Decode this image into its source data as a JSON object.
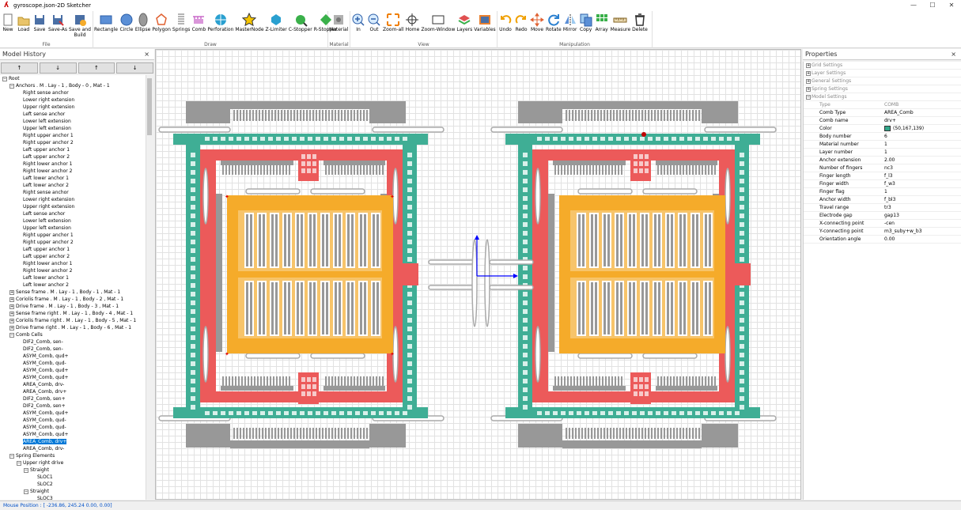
{
  "window": {
    "title": "gyroscope.json-2D Sketcher"
  },
  "toolbar": {
    "groups": [
      {
        "name": "File",
        "items": [
          "New",
          "Load",
          "Save",
          "Save-As",
          "Save and Build"
        ]
      },
      {
        "name": "Draw",
        "items": [
          "Rectangle",
          "Circle",
          "Ellipse",
          "Polygon",
          "Springs",
          "Comb",
          "Perforation",
          "MasterNode",
          "Z-Limiter",
          "C-Stopper",
          "R-Stopper"
        ]
      },
      {
        "name": "Material",
        "items": [
          "Material"
        ]
      },
      {
        "name": "View",
        "items": [
          "In",
          "Out",
          "Zoom-all",
          "Home",
          "Zoom-Window",
          "Layers",
          "Variables"
        ]
      },
      {
        "name": "Manipulation",
        "items": [
          "Undo",
          "Redo",
          "Move",
          "Rotate",
          "Mirror",
          "Copy",
          "Array",
          "Measure",
          "Delete"
        ]
      }
    ]
  },
  "model_history": {
    "title": "Model History",
    "close": "×",
    "arrows": [
      "↑",
      "↓",
      "↑",
      "↓"
    ],
    "tree": [
      {
        "level": 0,
        "exp": "−",
        "text": "Root"
      },
      {
        "level": 1,
        "exp": "−",
        "text": "Anchors . M . Lay - 1 , Body - 0 , Mat - 1"
      },
      {
        "level": 2,
        "text": "Right sense anchor"
      },
      {
        "level": 2,
        "text": "Lower right extension"
      },
      {
        "level": 2,
        "text": "Upper right extension"
      },
      {
        "level": 2,
        "text": "Left sense anchor"
      },
      {
        "level": 2,
        "text": "Lower left extension"
      },
      {
        "level": 2,
        "text": "Upper left extension"
      },
      {
        "level": 2,
        "text": "Right upper anchor 1"
      },
      {
        "level": 2,
        "text": "Right upper anchor 2"
      },
      {
        "level": 2,
        "text": "Left upper anchor 1"
      },
      {
        "level": 2,
        "text": "Left upper anchor 2"
      },
      {
        "level": 2,
        "text": "Right lower anchor 1"
      },
      {
        "level": 2,
        "text": "Right lower anchor 2"
      },
      {
        "level": 2,
        "text": "Left lower anchor 1"
      },
      {
        "level": 2,
        "text": "Left lower anchor 2"
      },
      {
        "level": 2,
        "text": "Right sense anchor"
      },
      {
        "level": 2,
        "text": "Lower right extension"
      },
      {
        "level": 2,
        "text": "Upper right extension"
      },
      {
        "level": 2,
        "text": "Left sense anchor"
      },
      {
        "level": 2,
        "text": "Lower left extension"
      },
      {
        "level": 2,
        "text": "Upper left extension"
      },
      {
        "level": 2,
        "text": "Right upper anchor 1"
      },
      {
        "level": 2,
        "text": "Right upper anchor 2"
      },
      {
        "level": 2,
        "text": "Left upper anchor 1"
      },
      {
        "level": 2,
        "text": "Left upper anchor 2"
      },
      {
        "level": 2,
        "text": "Right lower anchor 1"
      },
      {
        "level": 2,
        "text": "Right lower anchor 2"
      },
      {
        "level": 2,
        "text": "Left lower anchor 1"
      },
      {
        "level": 2,
        "text": "Left lower anchor 2"
      },
      {
        "level": 1,
        "exp": "+",
        "text": "Sense frame . M . Lay - 1 , Body - 1 , Mat - 1"
      },
      {
        "level": 1,
        "exp": "+",
        "text": "Coriolis frame . M . Lay - 1 , Body - 2 , Mat - 1"
      },
      {
        "level": 1,
        "exp": "+",
        "text": "Drive frame . M . Lay - 1 , Body - 3 , Mat - 1"
      },
      {
        "level": 1,
        "exp": "+",
        "text": "Sense frame right . M . Lay - 1 , Body - 4 , Mat - 1"
      },
      {
        "level": 1,
        "exp": "+",
        "text": "Coriolis frame right . M . Lay - 1 , Body - 5 , Mat - 1"
      },
      {
        "level": 1,
        "exp": "+",
        "text": "Drive frame right . M . Lay - 1 , Body - 6 , Mat - 1"
      },
      {
        "level": 1,
        "exp": "−",
        "text": "Comb Cells"
      },
      {
        "level": 2,
        "text": "DIF2_Comb, sen-"
      },
      {
        "level": 2,
        "text": "DIF2_Comb, sen-"
      },
      {
        "level": 2,
        "text": "ASYM_Comb, qud+"
      },
      {
        "level": 2,
        "text": "ASYM_Comb, qud-"
      },
      {
        "level": 2,
        "text": "ASYM_Comb, qud+"
      },
      {
        "level": 2,
        "text": "ASYM_Comb, qud+"
      },
      {
        "level": 2,
        "text": "AREA_Comb, drv-"
      },
      {
        "level": 2,
        "text": "AREA_Comb, drv+"
      },
      {
        "level": 2,
        "text": "DIF2_Comb, sen+"
      },
      {
        "level": 2,
        "text": "DIF2_Comb, sen+"
      },
      {
        "level": 2,
        "text": "ASYM_Comb, qud+"
      },
      {
        "level": 2,
        "text": "ASYM_Comb, qud-"
      },
      {
        "level": 2,
        "text": "ASYM_Comb, qud-"
      },
      {
        "level": 2,
        "text": "ASYM_Comb, qud+"
      },
      {
        "level": 2,
        "text": "AREA_Comb, drv+",
        "selected": true
      },
      {
        "level": 2,
        "text": "AREA_Comb, drv-"
      },
      {
        "level": 1,
        "exp": "−",
        "text": "Spring Elements"
      },
      {
        "level": 2,
        "exp": "−",
        "text": "Upper right drive"
      },
      {
        "level": 3,
        "exp": "−",
        "text": "Straight"
      },
      {
        "level": 4,
        "text": "SLOC1"
      },
      {
        "level": 4,
        "text": "SLOC2"
      },
      {
        "level": 3,
        "exp": "−",
        "text": "Straight"
      },
      {
        "level": 4,
        "text": "SLOC3"
      }
    ]
  },
  "properties": {
    "title": "Properties",
    "close": "×",
    "categories": [
      {
        "name": "Grid Settings",
        "exp": "+"
      },
      {
        "name": "Layer Settings",
        "exp": "+"
      },
      {
        "name": "General Settings",
        "exp": "+"
      },
      {
        "name": "Spring Settings",
        "exp": "+"
      },
      {
        "name": "Model Settings",
        "exp": "−"
      }
    ],
    "rows": [
      {
        "k": "Type",
        "v": "COMB",
        "gray": true
      },
      {
        "k": "Comb Type",
        "v": "AREA_Comb"
      },
      {
        "k": "Comb name",
        "v": "drv+"
      },
      {
        "k": "Color",
        "v": "(50,167,139)",
        "swatch": "#32a78b"
      },
      {
        "k": "Body number",
        "v": "6"
      },
      {
        "k": "Material number",
        "v": "1"
      },
      {
        "k": "Layer number",
        "v": "1"
      },
      {
        "k": "Anchor extension",
        "v": "2.00"
      },
      {
        "k": "Number of fingers",
        "v": "nc3"
      },
      {
        "k": "Finger length",
        "v": "f_l3"
      },
      {
        "k": "Finger width",
        "v": "f_w3"
      },
      {
        "k": "Finger flag",
        "v": "1"
      },
      {
        "k": "Anchor width",
        "v": "f_bl3"
      },
      {
        "k": "Travel range",
        "v": "tr3"
      },
      {
        "k": "Electrode gap",
        "v": "gap13"
      },
      {
        "k": "X-connecting point",
        "v": "-cen"
      },
      {
        "k": "Y-connecting point",
        "v": "m3_suby+w_b3"
      },
      {
        "k": "Orientation angle",
        "v": "0.00"
      }
    ]
  },
  "status": {
    "text": "Mouse Position : [ -236.86, 245.24    0.00, 0.00]"
  },
  "colors": {
    "teal": "#3fae95",
    "red": "#ec5a5a",
    "orange": "#f5ab2a",
    "gray": "#989898",
    "blue": "#0000ff"
  }
}
